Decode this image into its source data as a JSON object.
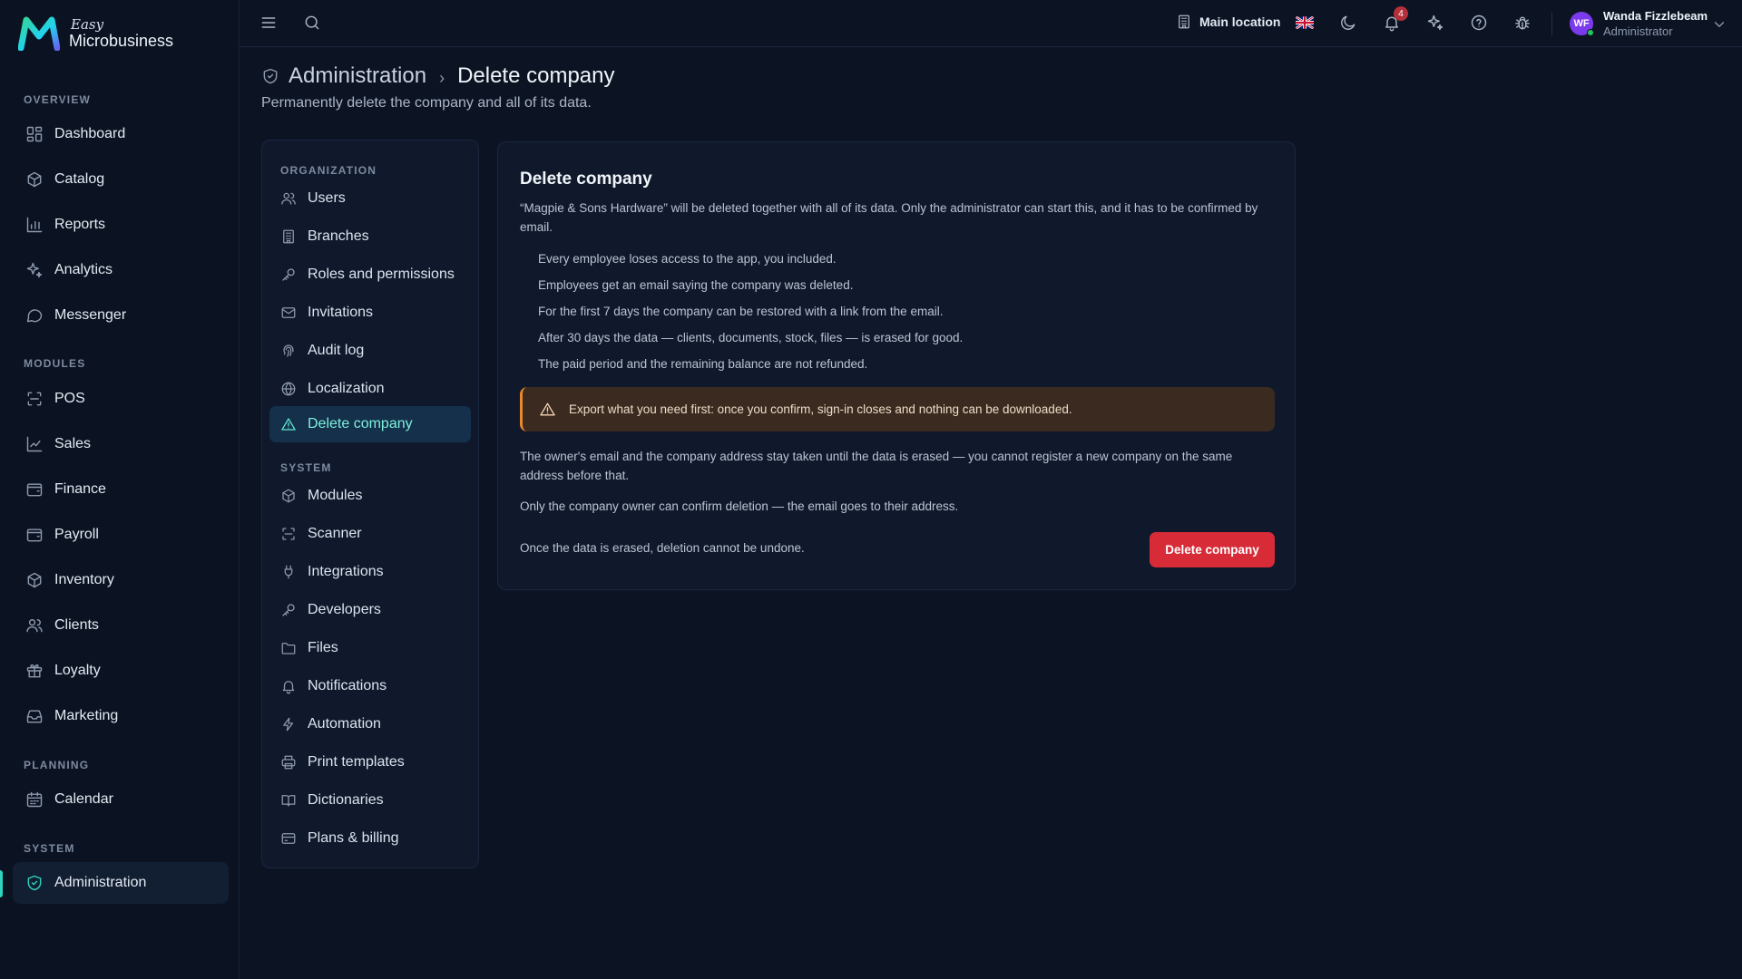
{
  "brand": {
    "easy": "Easy",
    "name": "Microbusiness"
  },
  "sidebar": {
    "sections": [
      {
        "label": "OVERVIEW",
        "items": [
          {
            "label": "Dashboard",
            "icon": "dashboard-icon"
          },
          {
            "label": "Catalog",
            "icon": "tag-icon"
          },
          {
            "label": "Reports",
            "icon": "bar-chart-icon"
          },
          {
            "label": "Analytics",
            "icon": "sparkle-icon"
          },
          {
            "label": "Messenger",
            "icon": "chat-icon"
          }
        ]
      },
      {
        "label": "MODULES",
        "items": [
          {
            "label": "POS",
            "icon": "scan-icon"
          },
          {
            "label": "Sales",
            "icon": "line-chart-icon"
          },
          {
            "label": "Finance",
            "icon": "wallet-icon"
          },
          {
            "label": "Payroll",
            "icon": "wallet-icon"
          },
          {
            "label": "Inventory",
            "icon": "box-icon"
          },
          {
            "label": "Clients",
            "icon": "users-icon"
          },
          {
            "label": "Loyalty",
            "icon": "gift-icon"
          },
          {
            "label": "Marketing",
            "icon": "inbox-icon"
          }
        ]
      },
      {
        "label": "PLANNING",
        "items": [
          {
            "label": "Calendar",
            "icon": "calendar-icon"
          }
        ]
      },
      {
        "label": "SYSTEM",
        "items": [
          {
            "label": "Administration",
            "icon": "shield-icon",
            "active": true
          }
        ]
      }
    ]
  },
  "topbar": {
    "location": "Main location",
    "notifications_count": "4",
    "user": {
      "initials": "WF",
      "name": "Wanda Fizzlebeam",
      "role": "Administrator"
    }
  },
  "page": {
    "breadcrumb_parent": "Administration",
    "breadcrumb_current": "Delete company",
    "subtitle": "Permanently delete the company and all of its data."
  },
  "settings_nav": {
    "sections": [
      {
        "label": "ORGANIZATION",
        "items": [
          {
            "label": "Users",
            "icon": "users-icon"
          },
          {
            "label": "Branches",
            "icon": "building-icon"
          },
          {
            "label": "Roles and permissions",
            "icon": "key-icon"
          },
          {
            "label": "Invitations",
            "icon": "mail-icon"
          },
          {
            "label": "Audit log",
            "icon": "fingerprint-icon"
          },
          {
            "label": "Localization",
            "icon": "globe-icon"
          },
          {
            "label": "Delete company",
            "icon": "warning-icon",
            "active": true
          }
        ]
      },
      {
        "label": "SYSTEM",
        "items": [
          {
            "label": "Modules",
            "icon": "box-icon"
          },
          {
            "label": "Scanner",
            "icon": "scan-icon"
          },
          {
            "label": "Integrations",
            "icon": "plug-icon"
          },
          {
            "label": "Developers",
            "icon": "key-icon"
          },
          {
            "label": "Files",
            "icon": "folder-icon"
          },
          {
            "label": "Notifications",
            "icon": "bell-icon"
          },
          {
            "label": "Automation",
            "icon": "bolt-icon"
          },
          {
            "label": "Print templates",
            "icon": "printer-icon"
          },
          {
            "label": "Dictionaries",
            "icon": "book-icon"
          },
          {
            "label": "Plans & billing",
            "icon": "credit-card-icon"
          }
        ]
      }
    ]
  },
  "card": {
    "title": "Delete company",
    "description": "“Magpie & Sons Hardware” will be deleted together with all of its data. Only the administrator can start this, and it has to be confirmed by email.",
    "consequences": [
      "Every employee loses access to the app, you included.",
      "Employees get an email saying the company was deleted.",
      "For the first 7 days the company can be restored with a link from the email.",
      "After 30 days the data — clients, documents, stock, files — is erased for good.",
      "The paid period and the remaining balance are not refunded."
    ],
    "warning": "Export what you need first: once you confirm, sign-in closes and nothing can be downloaded.",
    "owner_email_note": "The owner's email and the company address stay taken until the data is erased — you cannot register a new company on the same address before that.",
    "owner_only_note": "Only the company owner can confirm deletion — the email goes to their address.",
    "final_note": "Once the data is erased, deletion cannot be undone.",
    "delete_button": "Delete company"
  },
  "colors": {
    "accent": "#2dd4bf",
    "danger": "#d72b38",
    "warning_border": "#e8892b",
    "background": "#0c1424"
  }
}
